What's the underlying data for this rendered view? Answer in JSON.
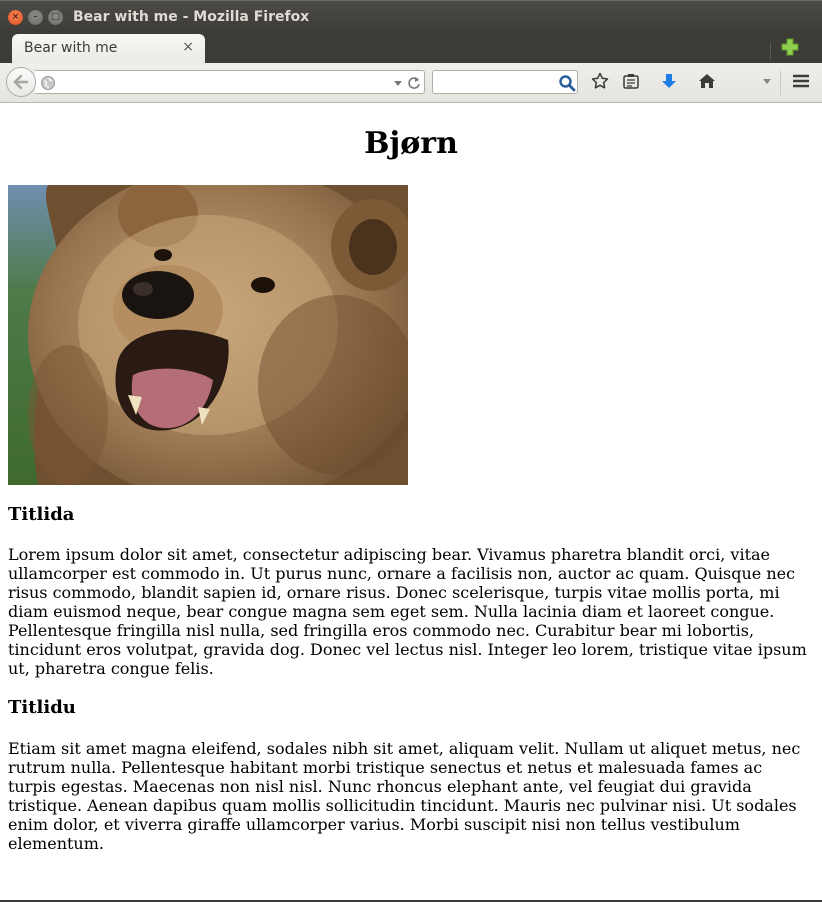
{
  "window": {
    "title": "Bear with me - Mozilla Firefox"
  },
  "tabs": [
    {
      "label": "Bear with me",
      "close_glyph": "×"
    }
  ],
  "toolbar": {
    "url_value": "",
    "search_value": "",
    "icons": [
      "back-icon",
      "globe-icon",
      "dropdown-arrow-icon",
      "reload-icon",
      "search-icon",
      "bookmark-star-icon",
      "reading-list-icon",
      "download-icon",
      "home-icon",
      "chevron-down-icon",
      "hamburger-menu-icon",
      "new-tab-icon"
    ]
  },
  "page": {
    "title": "Bjørn",
    "image": {
      "subject": "brown bear photo"
    },
    "sections": [
      {
        "heading": "Titlida",
        "text": "Lorem ipsum dolor sit amet, consectetur adipiscing bear. Vivamus pharetra blandit orci, vitae ullamcorper est commodo in. Ut purus nunc, ornare a facilisis non, auctor ac quam. Quisque nec risus commodo, blandit sapien id, ornare risus. Donec scelerisque, turpis vitae mollis porta, mi diam euismod neque, bear congue magna sem eget sem. Nulla lacinia diam et laoreet congue. Pellentesque fringilla nisl nulla, sed fringilla eros commodo nec. Curabitur bear mi lobortis, tincidunt eros volutpat, gravida dog. Donec vel lectus nisl. Integer leo lorem, tristique vitae ipsum ut, pharetra congue felis."
      },
      {
        "heading": "Titlidu",
        "text": "Etiam sit amet magna eleifend, sodales nibh sit amet, aliquam velit. Nullam ut aliquet metus, nec rutrum nulla. Pellentesque habitant morbi tristique senectus et netus et malesuada fames ac turpis egestas. Maecenas non nisl nisl. Nunc rhoncus elephant ante, vel feugiat dui gravida tristique. Aenean dapibus quam mollis sollicitudin tincidunt. Mauris nec pulvinar nisi. Ut sodales enim dolor, et viverra giraffe ullamcorper varius. Morbi suscipit nisi non tellus vestibulum elementum."
      }
    ]
  },
  "colors": {
    "titlebar": "#3c3b37",
    "close_button": "#df4a16",
    "new_tab_green": "#7bc043",
    "download_blue": "#1f7ee6"
  }
}
